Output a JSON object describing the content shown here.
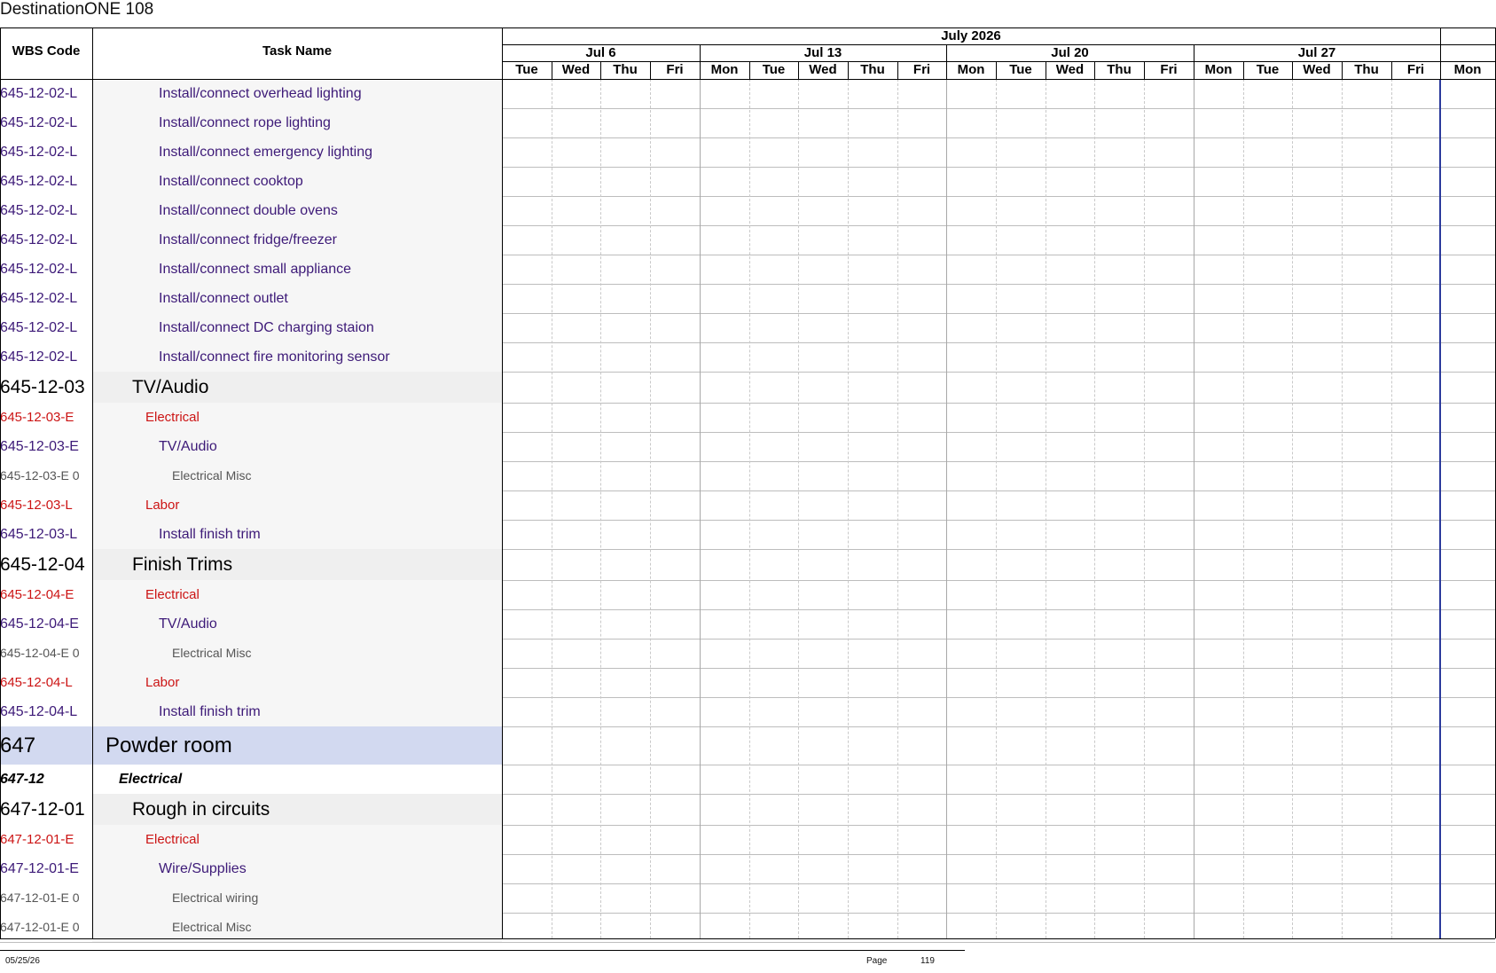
{
  "title": "DestinationONE 108",
  "headers": {
    "wbs": "WBS Code",
    "task": "Task Name",
    "month": "July 2026"
  },
  "weeks": [
    "Jul 6",
    "Jul 13",
    "Jul 20",
    "Jul 27"
  ],
  "days": [
    "Tue",
    "Wed",
    "Thu",
    "Fri",
    "Mon",
    "Tue",
    "Wed",
    "Thu",
    "Fri",
    "Mon",
    "Tue",
    "Wed",
    "Thu",
    "Fri",
    "Mon",
    "Tue",
    "Wed",
    "Thu",
    "Fri",
    "Mon"
  ],
  "rows": [
    {
      "code": "645-12-02-L",
      "task": "Install/connect overhead lighting",
      "style": "purple"
    },
    {
      "code": "645-12-02-L",
      "task": "Install/connect rope lighting",
      "style": "purple"
    },
    {
      "code": "645-12-02-L",
      "task": "Install/connect emergency lighting",
      "style": "purple"
    },
    {
      "code": "645-12-02-L",
      "task": "Install/connect cooktop",
      "style": "purple"
    },
    {
      "code": "645-12-02-L",
      "task": "Install/connect double ovens",
      "style": "purple"
    },
    {
      "code": "645-12-02-L",
      "task": "Install/connect fridge/freezer",
      "style": "purple"
    },
    {
      "code": "645-12-02-L",
      "task": "Install/connect small appliance",
      "style": "purple"
    },
    {
      "code": "645-12-02-L",
      "task": "Install/connect outlet",
      "style": "purple"
    },
    {
      "code": "645-12-02-L",
      "task": "Install/connect DC charging staion",
      "style": "purple"
    },
    {
      "code": "645-12-02-L",
      "task": "Install/connect fire monitoring sensor",
      "style": "purple"
    },
    {
      "code": "645-12-03",
      "task": "TV/Audio",
      "style": "big"
    },
    {
      "code": "645-12-03-E",
      "task": "Electrical",
      "style": "red"
    },
    {
      "code": "645-12-03-E",
      "task": "TV/Audio",
      "style": "purple"
    },
    {
      "code": "645-12-03-E 0",
      "task": "Electrical Misc",
      "style": "grey"
    },
    {
      "code": "645-12-03-L",
      "task": "Labor",
      "style": "red"
    },
    {
      "code": "645-12-03-L",
      "task": "Install finish trim",
      "style": "purple"
    },
    {
      "code": "645-12-04",
      "task": "Finish Trims",
      "style": "big"
    },
    {
      "code": "645-12-04-E",
      "task": "Electrical",
      "style": "red"
    },
    {
      "code": "645-12-04-E",
      "task": "TV/Audio",
      "style": "purple"
    },
    {
      "code": "645-12-04-E 0",
      "task": "Electrical Misc",
      "style": "grey"
    },
    {
      "code": "645-12-04-L",
      "task": "Labor",
      "style": "red"
    },
    {
      "code": "645-12-04-L",
      "task": "Install finish trim",
      "style": "purple"
    },
    {
      "code": "647",
      "task": "Powder room",
      "style": "huge"
    },
    {
      "code": "647-12",
      "task": "Electrical",
      "style": "bi"
    },
    {
      "code": "647-12-01",
      "task": "Rough in circuits",
      "style": "big"
    },
    {
      "code": "647-12-01-E",
      "task": "Electrical",
      "style": "red"
    },
    {
      "code": "647-12-01-E",
      "task": "Wire/Supplies",
      "style": "purple"
    },
    {
      "code": "647-12-01-E 0",
      "task": "Electrical wiring",
      "style": "grey"
    },
    {
      "code": "647-12-01-E 0",
      "task": "Electrical Misc",
      "style": "grey"
    }
  ],
  "colors": {
    "purple": "#3d1a78",
    "red": "#cc1414",
    "grey": "#555555",
    "huge_bg": "#d2d9f0",
    "big_bg": "#efefef",
    "row_bg": "#f6f6f6",
    "today_line": "#2b3a9c"
  },
  "footer": {
    "date": "05/25/26",
    "page_label": "Page",
    "page_number": "119"
  }
}
